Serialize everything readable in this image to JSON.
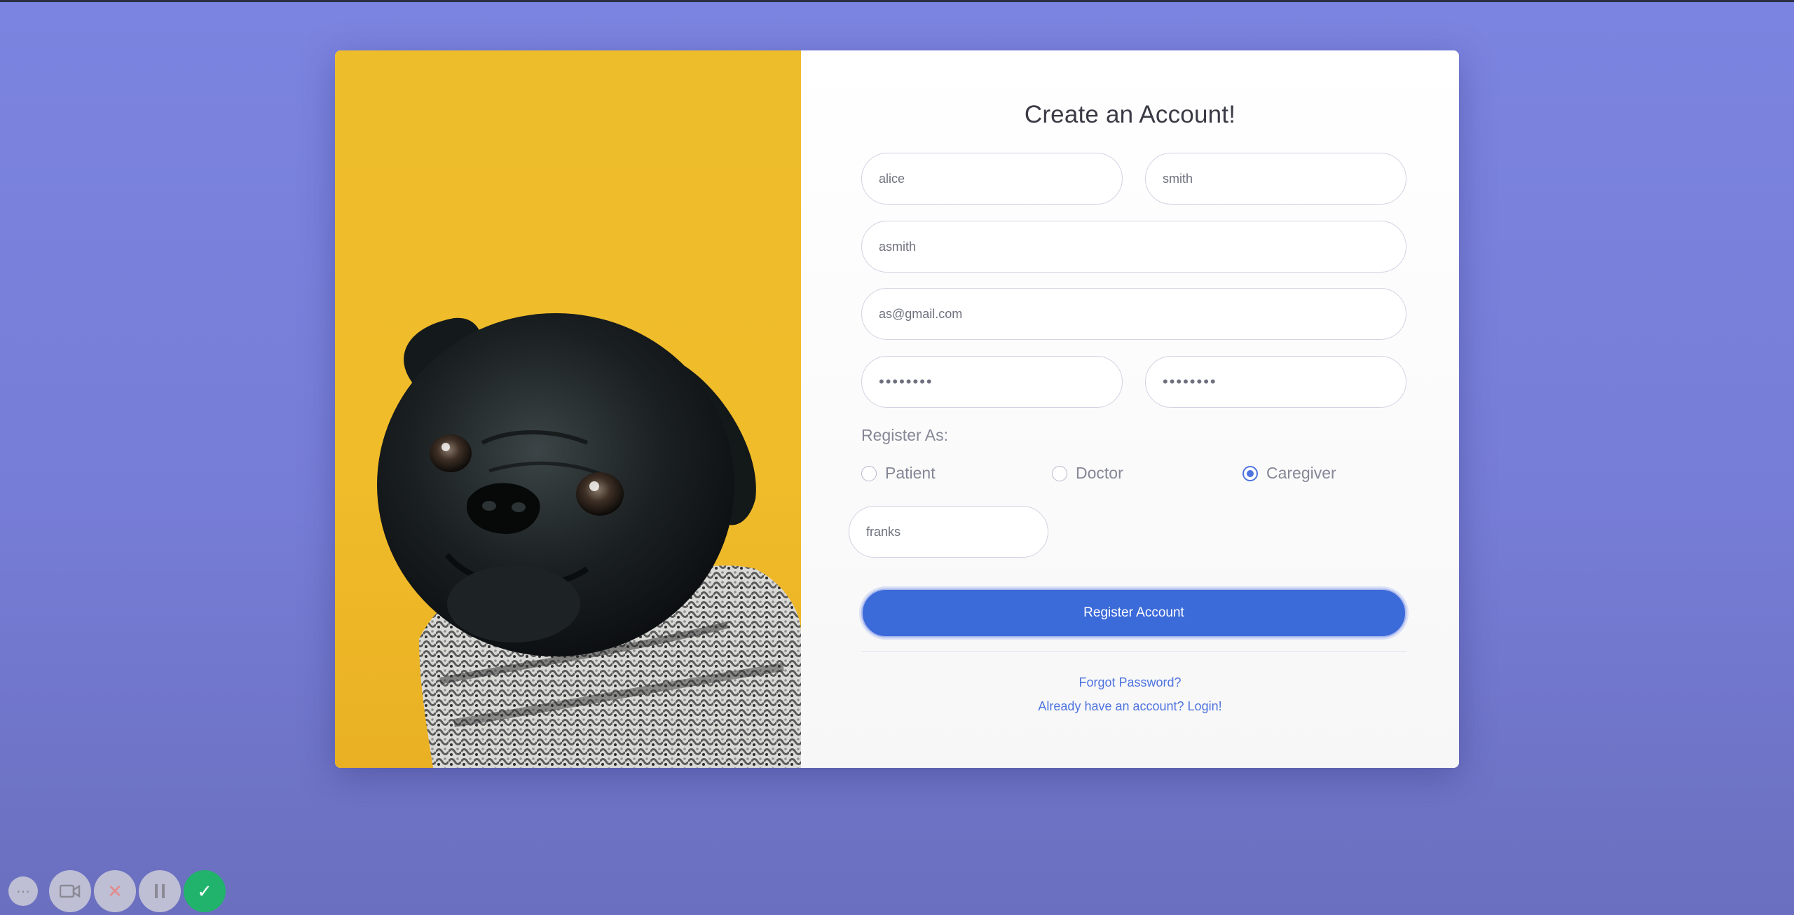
{
  "form": {
    "title": "Create an Account!",
    "first_name": "alice",
    "last_name": "smith",
    "username": "asmith",
    "email": "as@gmail.com",
    "password": "••••••••",
    "repeat_password": "••••••••",
    "register_as_label": "Register As:",
    "roles": [
      {
        "label": "Patient",
        "selected": false
      },
      {
        "label": "Doctor",
        "selected": false
      },
      {
        "label": "Caregiver",
        "selected": true
      }
    ],
    "caregiver_field": "franks",
    "submit_label": "Register Account",
    "forgot_password_link": "Forgot Password?",
    "login_link": "Already have an account? Login!"
  },
  "colors": {
    "background": "#7b84e0",
    "primary": "#3b6ad9",
    "photo_background": "#efbc2b",
    "confirm": "#21b36b"
  },
  "recorder_toolbar": {
    "icons": [
      "more-icon",
      "camera-icon",
      "cancel-icon",
      "pause-icon",
      "check-icon"
    ]
  }
}
